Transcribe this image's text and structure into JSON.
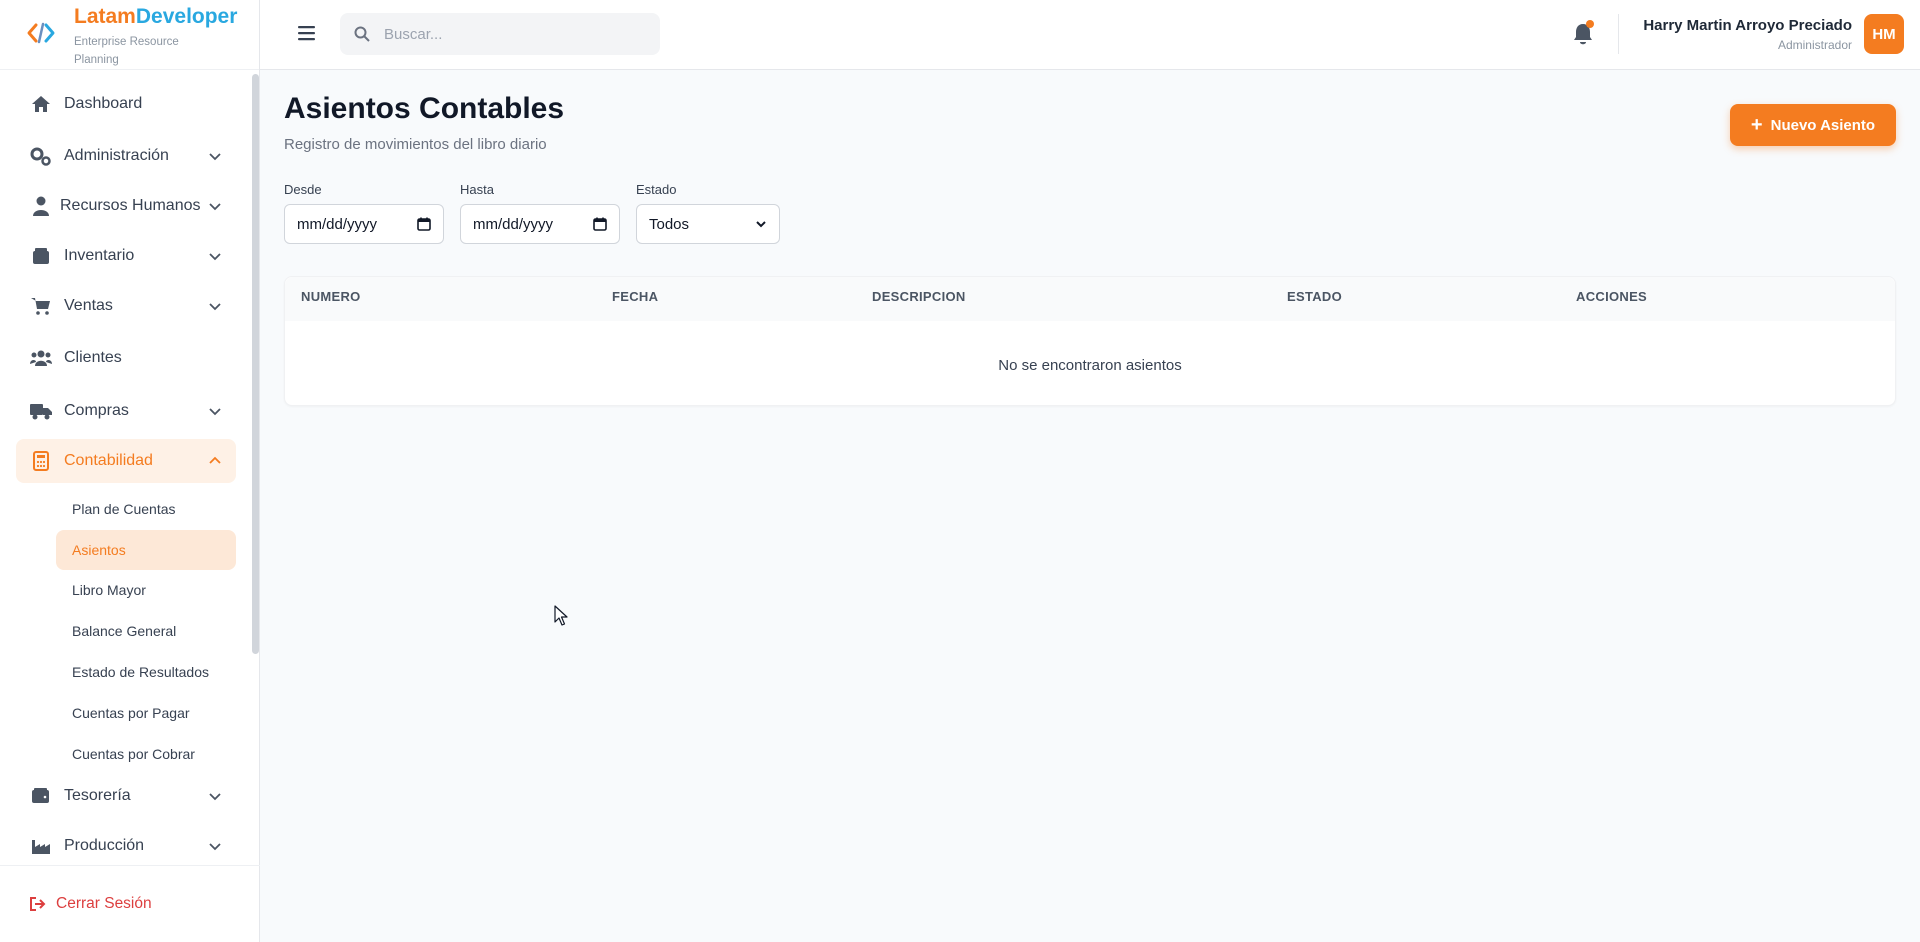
{
  "brand": {
    "name_part1": "Latam",
    "name_part2": "Developer",
    "subtitle": "Enterprise Resource Planning",
    "accent_color": "#f47c20",
    "secondary_color": "#29a8e0"
  },
  "sidebar": {
    "items": [
      {
        "label": "Dashboard",
        "icon": "home-icon"
      },
      {
        "label": "Administración",
        "icon": "gears-icon"
      },
      {
        "label": "Recursos Humanos",
        "icon": "user-tie-icon"
      },
      {
        "label": "Inventario",
        "icon": "box-icon"
      },
      {
        "label": "Ventas",
        "icon": "cart-icon"
      },
      {
        "label": "Clientes",
        "icon": "users-icon"
      },
      {
        "label": "Compras",
        "icon": "truck-icon"
      },
      {
        "label": "Contabilidad",
        "icon": "calculator-icon"
      },
      {
        "label": "Tesorería",
        "icon": "wallet-icon"
      },
      {
        "label": "Producción",
        "icon": "industry-icon"
      }
    ],
    "sub_items": [
      {
        "label": "Plan de Cuentas"
      },
      {
        "label": "Asientos"
      },
      {
        "label": "Libro Mayor"
      },
      {
        "label": "Balance General"
      },
      {
        "label": "Estado de Resultados"
      },
      {
        "label": "Cuentas por Pagar"
      },
      {
        "label": "Cuentas por Cobrar"
      }
    ],
    "logout_label": "Cerrar Sesión"
  },
  "topbar": {
    "search_placeholder": "Buscar...",
    "user_name": "Harry Martin Arroyo Preciado",
    "user_role": "Administrador",
    "avatar_initials": "HM"
  },
  "main": {
    "title": "Asientos Contables",
    "subtitle": "Registro de movimientos del libro diario",
    "new_button_label": "Nuevo Asiento",
    "filters": {
      "from_label": "Desde",
      "from_value": "mm/dd/yyyy",
      "to_label": "Hasta",
      "to_value": "mm/dd/yyyy",
      "status_label": "Estado",
      "status_value": "Todos"
    },
    "table": {
      "columns": [
        "NUMERO",
        "FECHA",
        "DESCRIPCION",
        "ESTADO",
        "ACCIONES"
      ],
      "empty_message": "No se encontraron asientos"
    }
  }
}
